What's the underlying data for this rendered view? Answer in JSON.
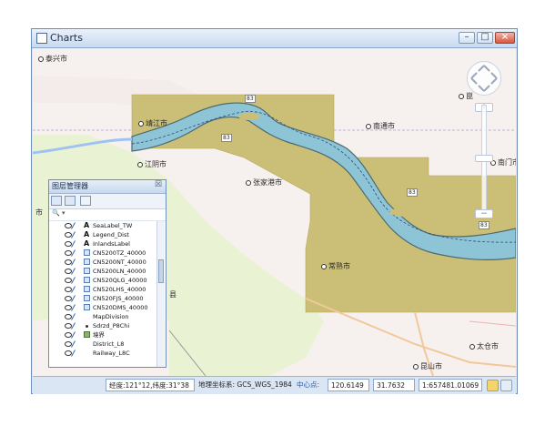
{
  "window": {
    "title": "Charts",
    "minimize_label": "–",
    "maximize_label": "□",
    "close_label": "×"
  },
  "map": {
    "labels": [
      {
        "text": "泰兴市"
      },
      {
        "text": "靖江市"
      },
      {
        "text": "南通市"
      },
      {
        "text": "江阴市"
      },
      {
        "text": "张家港市"
      },
      {
        "text": "常熟市"
      },
      {
        "text": "太仓市"
      },
      {
        "text": "昆山市"
      },
      {
        "text": "崑"
      },
      {
        "text": "市"
      },
      {
        "text": "南门市"
      },
      {
        "text": "县"
      }
    ],
    "chart_markers": [
      "83",
      "83",
      "83",
      "83"
    ]
  },
  "layer_panel": {
    "title": "图层管理器",
    "close_label": "☒",
    "search_placeholder": "🔍 ▾",
    "layers": [
      {
        "name": "SeaLabel_TW",
        "icon": "A"
      },
      {
        "name": "Legend_Dist",
        "icon": "A"
      },
      {
        "name": "InlandsLabel",
        "icon": "A"
      },
      {
        "name": "CN5200TZ_40000",
        "icon": "chart"
      },
      {
        "name": "CN5200NT_40000",
        "icon": "chart"
      },
      {
        "name": "CN5200LN_40000",
        "icon": "chart"
      },
      {
        "name": "CN520QLG_40000",
        "icon": "chart"
      },
      {
        "name": "CN520LHS_40000",
        "icon": "chart"
      },
      {
        "name": "CN520FJS_40000",
        "icon": "chart"
      },
      {
        "name": "CN520DMS_40000",
        "icon": "chart"
      },
      {
        "name": "MapDivision",
        "icon": "none"
      },
      {
        "name": "Sdrzd_P8Chi",
        "icon": "dot"
      },
      {
        "name": "境界",
        "icon": "img"
      },
      {
        "name": "District_L8",
        "icon": "none"
      },
      {
        "name": "Railway_L8C",
        "icon": "none"
      }
    ]
  },
  "status": {
    "coords": "经度:121°12,纬度:31°38",
    "crs_label": "地理坐标系: GCS_WGS_1984",
    "center_label": "中心点:",
    "center_lon": "120.6149",
    "center_lat": "31.7632",
    "scale": "1:657481.01069"
  }
}
